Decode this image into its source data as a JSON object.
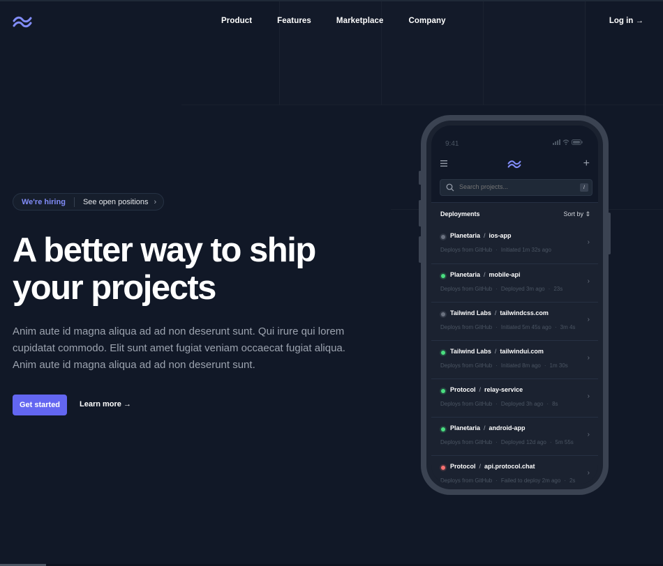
{
  "brand": {
    "logo_icon": "tailwind-wave-logo",
    "accent": "#6366f1",
    "accent_light": "#818cf8"
  },
  "nav": {
    "items": [
      "Product",
      "Features",
      "Marketplace",
      "Company"
    ],
    "login": "Log in →"
  },
  "hero": {
    "badge": {
      "hiring": "We're hiring",
      "link": "See open positions",
      "chevron": "›"
    },
    "title_line1": "A better way to ship",
    "title_line2": "your projects",
    "lede": "Anim aute id magna aliqua ad ad non deserunt sunt. Qui irure qui lorem cupidatat commodo. Elit sunt amet fugiat veniam occaecat fugiat aliqua. Anim aute id magna aliqua ad ad non deserunt sunt.",
    "cta_primary": "Get started",
    "cta_secondary": "Learn more →"
  },
  "phone": {
    "time": "9:41",
    "search_placeholder": "Search projects...",
    "search_shortcut": "/",
    "plus": "+",
    "list_title": "Deployments",
    "sort_label": "Sort by",
    "deployments": [
      {
        "project": "Planetaria",
        "repo": "ios-app",
        "status": "grey",
        "source": "Deploys from GitHub",
        "info": "Initiated 1m 32s ago",
        "duration": ""
      },
      {
        "project": "Planetaria",
        "repo": "mobile-api",
        "status": "green",
        "source": "Deploys from GitHub",
        "info": "Deployed 3m ago",
        "duration": "23s"
      },
      {
        "project": "Tailwind Labs",
        "repo": "tailwindcss.com",
        "status": "grey",
        "source": "Deploys from GitHub",
        "info": "Initiated 5m 45s ago",
        "duration": "3m 4s"
      },
      {
        "project": "Tailwind Labs",
        "repo": "tailwindui.com",
        "status": "green",
        "source": "Deploys from GitHub",
        "info": "Initiated 8m ago",
        "duration": "1m 30s"
      },
      {
        "project": "Protocol",
        "repo": "relay-service",
        "status": "green",
        "source": "Deploys from GitHub",
        "info": "Deployed 3h ago",
        "duration": "8s"
      },
      {
        "project": "Planetaria",
        "repo": "android-app",
        "status": "green",
        "source": "Deploys from GitHub",
        "info": "Deployed 12d ago",
        "duration": "5m 55s"
      },
      {
        "project": "Protocol",
        "repo": "api.protocol.chat",
        "status": "red",
        "source": "Deploys from GitHub",
        "info": "Failed to deploy 2m ago",
        "duration": "2s"
      }
    ]
  }
}
